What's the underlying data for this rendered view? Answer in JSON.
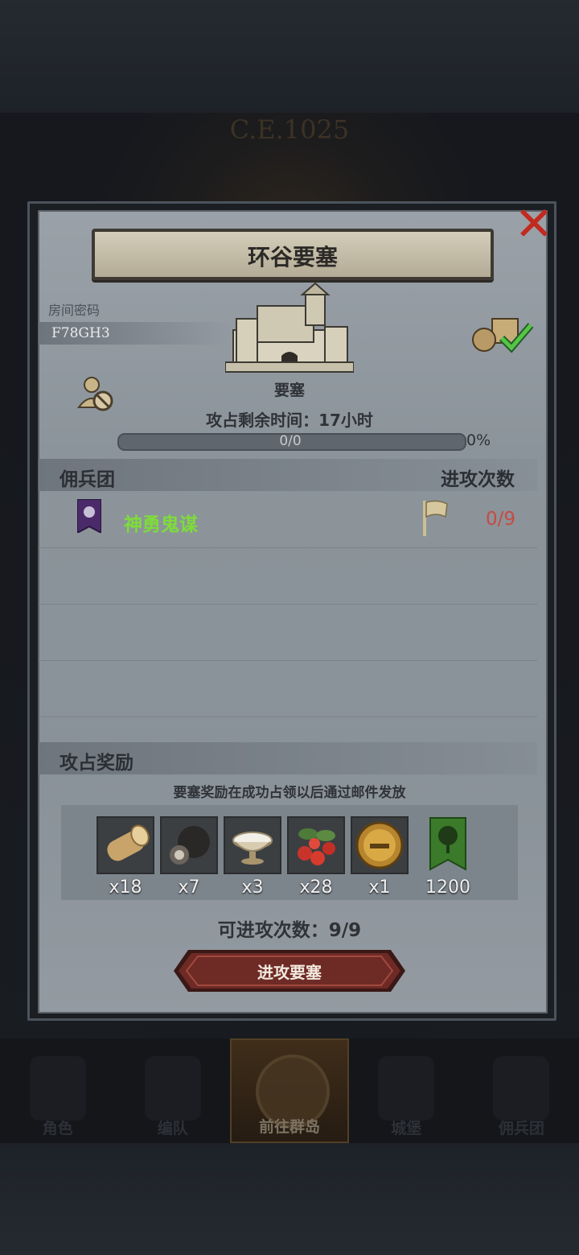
{
  "background": {
    "era_text": "C.E.1025"
  },
  "dialog": {
    "title": "环谷要塞",
    "room": {
      "label": "房间密码",
      "code": "F78GH3"
    },
    "fortress": {
      "type_label": "要塞",
      "time_label": "攻占剩余时间：17小时"
    },
    "progress": {
      "text": "0/0",
      "percent_text": "0%",
      "fraction": 0
    },
    "table": {
      "left_header": "佣兵团",
      "right_header": "进攻次数",
      "rows": [
        {
          "guild_name": "神勇鬼谋",
          "attacks": "0/9"
        }
      ]
    },
    "rewards": {
      "section_title": "攻占奖励",
      "note": "要塞奖励在成功占领以后通过邮件发放",
      "items": [
        {
          "icon": "log-icon",
          "qty": "x18"
        },
        {
          "icon": "truffle-icon",
          "qty": "x7"
        },
        {
          "icon": "salt-bowl-icon",
          "qty": "x3"
        },
        {
          "icon": "berries-icon",
          "qty": "x28"
        },
        {
          "icon": "gold-helmet-coin-icon",
          "qty": "x1"
        },
        {
          "icon": "tree-banner-icon",
          "qty": "1200"
        }
      ]
    },
    "attempts_text": "可进攻次数：9/9",
    "attack_button": "进攻要塞"
  },
  "nav": {
    "items": [
      {
        "label": "角色",
        "active": false
      },
      {
        "label": "编队",
        "active": false
      },
      {
        "label": "前往群岛",
        "active": true
      },
      {
        "label": "城堡",
        "active": false
      },
      {
        "label": "佣兵团",
        "active": false
      }
    ]
  },
  "colors": {
    "guild_name": "#7edc3a",
    "attack_count": "#c84a42",
    "close_x": "#c22a1f",
    "attack_button": "#6e2a25"
  }
}
